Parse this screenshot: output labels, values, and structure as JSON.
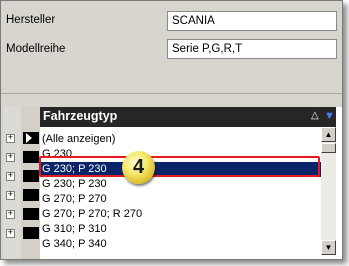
{
  "form": {
    "manufacturer_label": "Hersteller",
    "manufacturer_value": "SCANIA",
    "series_label": "Modellreihe",
    "series_value": "Serie P,G,R,T"
  },
  "grid": {
    "column_header": "Fahrzeugtyp",
    "sort_icon": "sort-triangle-icon",
    "filter_icon": "filter-funnel-icon",
    "rows": [
      "(Alle anzeigen)",
      "G 230",
      "G 230; P 230",
      "G 230; P 230",
      "G 270; P 270",
      "G 270; P 270; R 270",
      "G 310; P 310",
      "G 340; P 340"
    ],
    "selected_row_index": 2
  },
  "callout": {
    "number": "4"
  },
  "colors": {
    "selection": "#0a246a",
    "highlight_border": "#e5191e",
    "header_bg": "#262626",
    "badge": "#f5e76a"
  }
}
